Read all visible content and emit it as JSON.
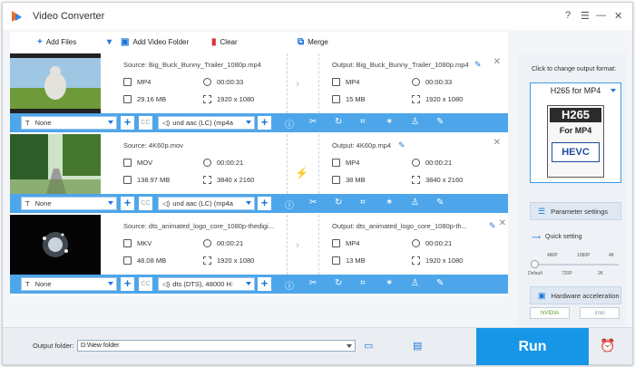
{
  "app": {
    "title": "Video Converter",
    "window_controls": [
      "?",
      "☰",
      "—",
      "✕"
    ]
  },
  "toolbar": {
    "add_files": "Add Files",
    "add_video_folder": "Add Video Folder",
    "clear": "Clear",
    "merge": "Merge"
  },
  "files": [
    {
      "source": "Source: Big_Buck_Bunny_Trailer_1080p.mp4",
      "output": "Output: Big_Buck_Bunny_Trailer_1080p.mp4",
      "in_format": "MP4",
      "in_duration": "00:00:33",
      "in_size": "29.16 MB",
      "in_resolution": "1920 x 1080",
      "out_format": "MP4",
      "out_duration": "00:00:33",
      "out_size": "15 MB",
      "out_resolution": "1920 x 1080",
      "subtitle": "None",
      "audio": "und aac (LC) (mp4a"
    },
    {
      "source": "Source: 4K60p.mov",
      "output": "Output: 4K60p.mp4",
      "in_format": "MOV",
      "in_duration": "00:00:21",
      "in_size": "138.97 MB",
      "in_resolution": "3840 x 2160",
      "out_format": "MP4",
      "out_duration": "00:00:21",
      "out_size": "38 MB",
      "out_resolution": "3840 x 2160",
      "subtitle": "None",
      "audio": "und aac (LC) (mp4a"
    },
    {
      "source": "Source: dts_animated_logo_core_1080p-thedigi...",
      "output": "Output: dts_animated_logo_core_1080p-th...",
      "in_format": "MKV",
      "in_duration": "00:00:21",
      "in_size": "48.08 MB",
      "in_resolution": "1920 x 1080",
      "out_format": "MP4",
      "out_duration": "00:00:21",
      "out_size": "13 MB",
      "out_resolution": "1920 x 1080",
      "subtitle": "None",
      "audio": "dts (DTS), 48000 H:"
    }
  ],
  "sidebar": {
    "hint": "Click to change output format:",
    "format_name": "H265 for MP4",
    "format_icon_top": "H265",
    "format_icon_mid": "For MP4",
    "format_icon_bottom": "HEVC",
    "parameter_settings": "Parameter settings",
    "quick_setting": "Quick setting",
    "quality_top": [
      "480P",
      "1080P",
      "4K"
    ],
    "quality_bottom": [
      "Default",
      "720P",
      "2K"
    ],
    "hardware_acceleration": "Hardware acceleration",
    "nvidia": "NVIDIA",
    "intel": "Intel"
  },
  "bottom": {
    "output_folder_label": "Output folder:",
    "output_folder_value": "D:\\New folder",
    "run": "Run"
  }
}
